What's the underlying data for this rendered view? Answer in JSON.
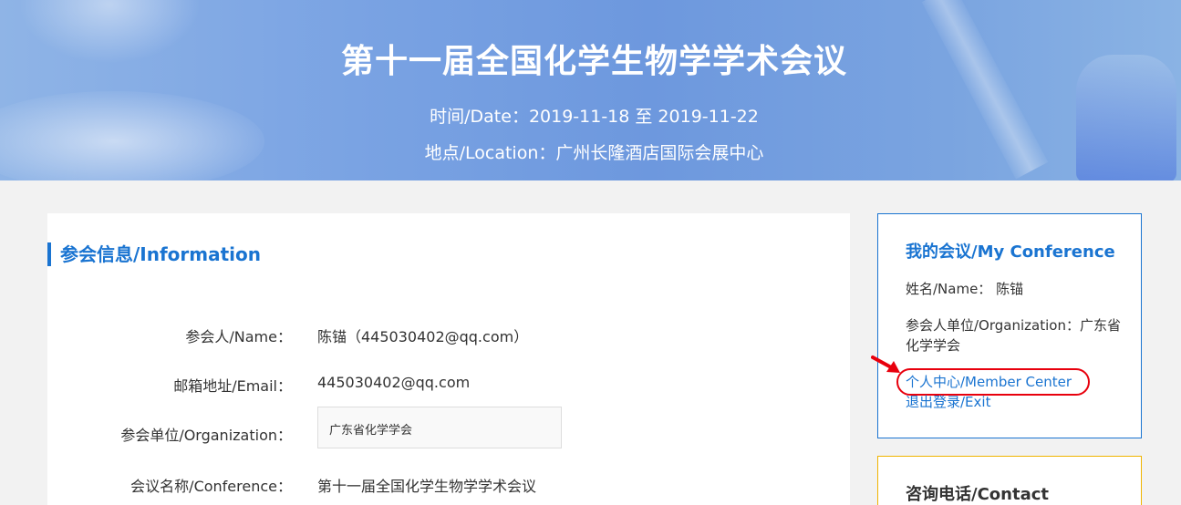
{
  "banner": {
    "title": "第十一届全国化学生物学学术会议",
    "date_line": "时间/Date：2019-11-18 至 2019-11-22",
    "location_line": "地点/Location：广州长隆酒店国际会展中心"
  },
  "info": {
    "section_title": "参会信息/Information",
    "rows": [
      {
        "label": "参会人/Name：",
        "value": "陈锚（445030402@qq.com）"
      },
      {
        "label": "邮箱地址/Email：",
        "value": "445030402@qq.com"
      },
      {
        "label": "参会单位/Organization：",
        "value": "广东省化学学会"
      },
      {
        "label": "会议名称/Conference：",
        "value": "第十一届全国化学生物学学术会议"
      }
    ]
  },
  "sidebar": {
    "title": "我的会议/My Conference",
    "name_line": "姓名/Name： 陈锚",
    "org_line": "参会人单位/Organization：广东省化学学会",
    "member_center_link": "个人中心/Member Center",
    "exit_link": "退出登录/Exit"
  },
  "contact": {
    "title": "咨询电话/Contact"
  },
  "colors": {
    "accent": "#1a74d1",
    "highlight": "#e8000d",
    "contact_border": "#f0b400"
  }
}
